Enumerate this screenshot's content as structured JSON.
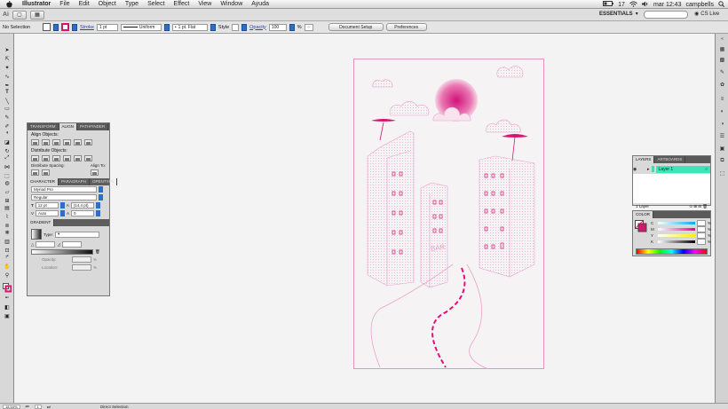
{
  "menubar": {
    "app_name": "Illustrator",
    "items": [
      "File",
      "Edit",
      "Object",
      "Type",
      "Select",
      "Effect",
      "View",
      "Window",
      "Ayuda"
    ],
    "battery": "17",
    "clock": "mar 12:43",
    "user": "campbells"
  },
  "appbar": {
    "logo": "Ai",
    "workspace": "ESSENTIALS",
    "cs_live": "CS Live"
  },
  "control": {
    "selection": "No Selection",
    "stroke_label": "Stroke",
    "stroke_weight": "1 pt",
    "stroke_profile": "Uniform",
    "brush": "1 pt. Flat",
    "style_label": "Style",
    "opacity_label": "Opacity",
    "opacity_value": "100",
    "opacity_unit": "%",
    "document_setup": "Document Setup",
    "preferences": "Preferences",
    "fill_color": "#ffffff",
    "stroke_color": "#d4166f"
  },
  "align_panel": {
    "tabs": [
      "TRANSFORM",
      "ALIGN",
      "PATHFINDER"
    ],
    "align_objects": "Align Objects:",
    "distribute_objects": "Distribute Objects:",
    "distribute_spacing": "Distribute Spacing:",
    "align_to": "Align To:"
  },
  "character_panel": {
    "tabs": [
      "CHARACTER",
      "PARAGRAPH",
      "OPENTYPE"
    ],
    "font_family": "Myriad Pro",
    "font_style": "Regular",
    "font_size": "12 pt",
    "leading": "(14,4 pt)",
    "kerning": "Auto",
    "tracking": "0"
  },
  "gradient_panel": {
    "tab": "GRADIENT",
    "type_label": "Type:",
    "opacity_label": "Opacity:",
    "location_label": "Location:",
    "percent": "%"
  },
  "layers_panel": {
    "tabs": [
      "LAYERS",
      "ARTBOARDS"
    ],
    "layer_name": "Layer 1",
    "footer": "1 Layer"
  },
  "color_panel": {
    "tab": "COLOR",
    "channels": [
      "C",
      "M",
      "Y",
      "K"
    ],
    "percent": "%"
  },
  "status": {
    "zoom": "18,54%",
    "page": "1",
    "tool": "Direct Selection"
  },
  "artwork": {
    "sign_text": "BAR",
    "accent": "#e0117a",
    "light": "#f2bcd8"
  }
}
